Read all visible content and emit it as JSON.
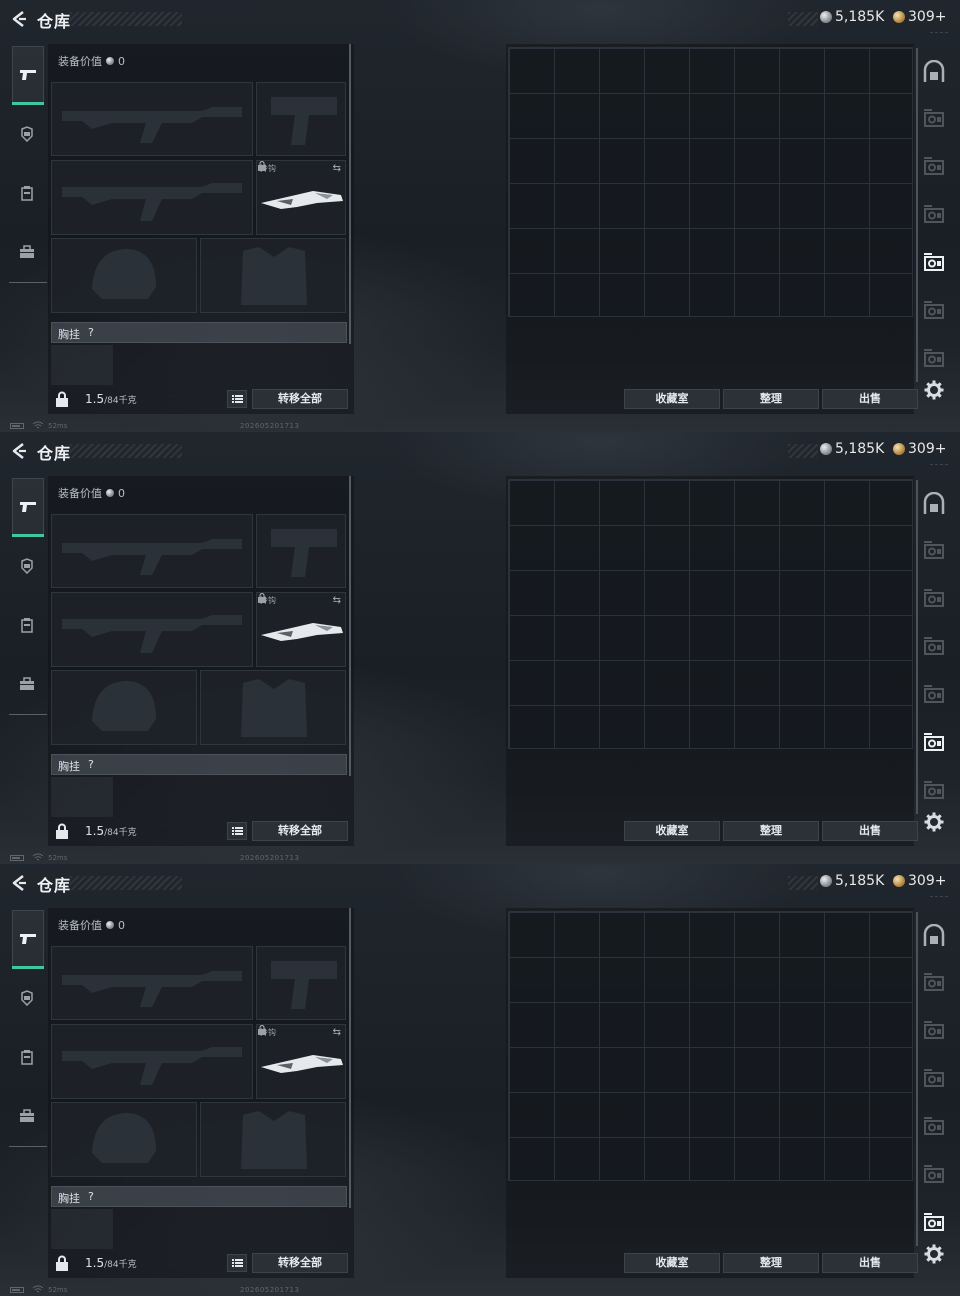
{
  "screens": [
    {
      "selected_tab": 4
    },
    {
      "selected_tab": 5
    },
    {
      "selected_tab": 6
    }
  ],
  "header": {
    "title": "仓库",
    "back_icon": "back-arrow-icon",
    "currency_silver": "5,185K",
    "currency_gold": "309+"
  },
  "equipment": {
    "value_label": "装备价值",
    "value": "0",
    "melee_label": "拎钩",
    "chest_rig_label": "胸挂",
    "chest_rig_help": "?",
    "weight_current": "1.5",
    "weight_max": "/84千克",
    "transfer_all": "转移全部"
  },
  "storage": {
    "collection_button": "收藏室",
    "sort_button": "整理",
    "sell_button": "出售"
  },
  "status": {
    "ping": "52ms",
    "build": "202605201713"
  },
  "colors": {
    "accent_green": "#3fc7a2",
    "background": "#1a1f25"
  }
}
